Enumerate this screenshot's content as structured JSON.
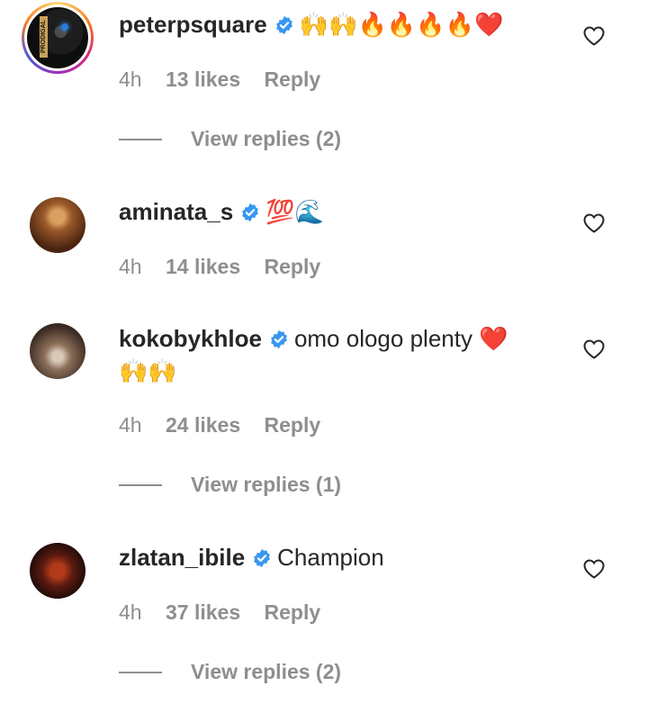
{
  "comments": [
    {
      "username": "peterpsquare",
      "verified": true,
      "text": "🙌🙌🔥🔥🔥🔥❤️",
      "time": "4h",
      "likes": "13 likes",
      "reply": "Reply",
      "view_replies": "View replies (2)",
      "avatar_text": "PRODIGAL"
    },
    {
      "username": "aminata_s",
      "verified": true,
      "text": "💯🌊",
      "time": "4h",
      "likes": "14 likes",
      "reply": "Reply",
      "view_replies": ""
    },
    {
      "username": "kokobykhloe",
      "verified": true,
      "text": "omo ologo plenty ❤️ 🙌🙌",
      "time": "4h",
      "likes": "24 likes",
      "reply": "Reply",
      "view_replies": "View replies (1)"
    },
    {
      "username": "zlatan_ibile",
      "verified": true,
      "text": "Champion",
      "time": "4h",
      "likes": "37 likes",
      "reply": "Reply",
      "view_replies": "View replies (2)"
    }
  ],
  "colors": {
    "verified_blue": "#3897f0",
    "muted": "#8e8e8e",
    "text": "#262626"
  }
}
